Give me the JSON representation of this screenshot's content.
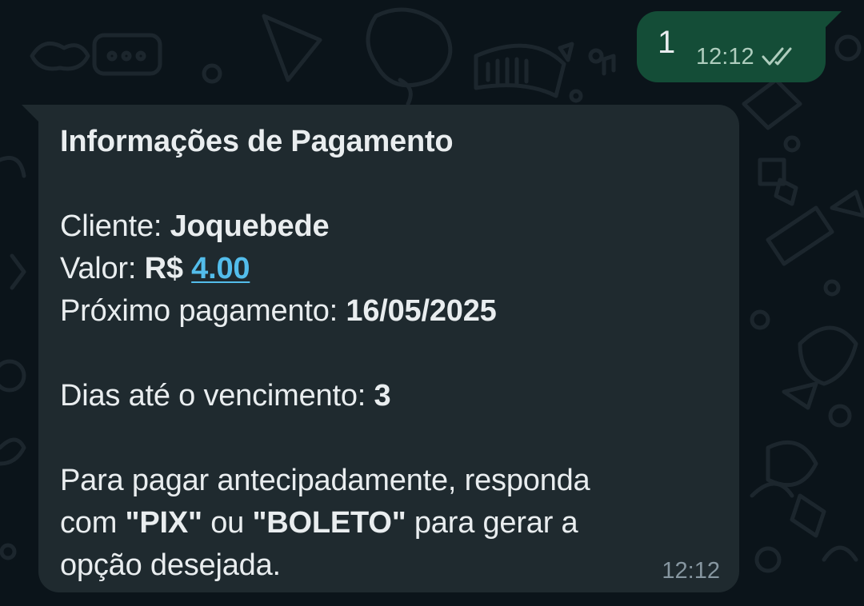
{
  "outgoing": {
    "text": "1",
    "time": "12:12",
    "status_icon": "double-check-icon"
  },
  "incoming": {
    "title": "Informações de Pagamento",
    "client_label": "Cliente: ",
    "client_value": "Joquebede",
    "value_label": "Valor: ",
    "value_currency": "R$ ",
    "value_amount": "4.00",
    "next_label": "Próximo pagamento: ",
    "next_value": "16/05/2025",
    "days_label": "Dias até o vencimento: ",
    "days_value": "3",
    "pay_line1": "Para pagar antecipadamente, responda",
    "pay_line2_a": "com ",
    "pay_line2_pix": "\"PIX\"",
    "pay_line2_b": " ou ",
    "pay_line2_boleto": "\"BOLETO\"",
    "pay_line2_c": " para gerar a",
    "pay_line3": "opção desejada.",
    "time": "12:12"
  },
  "colors": {
    "background": "#0b141a",
    "outgoing_bubble": "#144d37",
    "incoming_bubble": "#1f2a2f",
    "link": "#53bdeb",
    "text": "#e9edef",
    "meta": "#8696a0"
  }
}
